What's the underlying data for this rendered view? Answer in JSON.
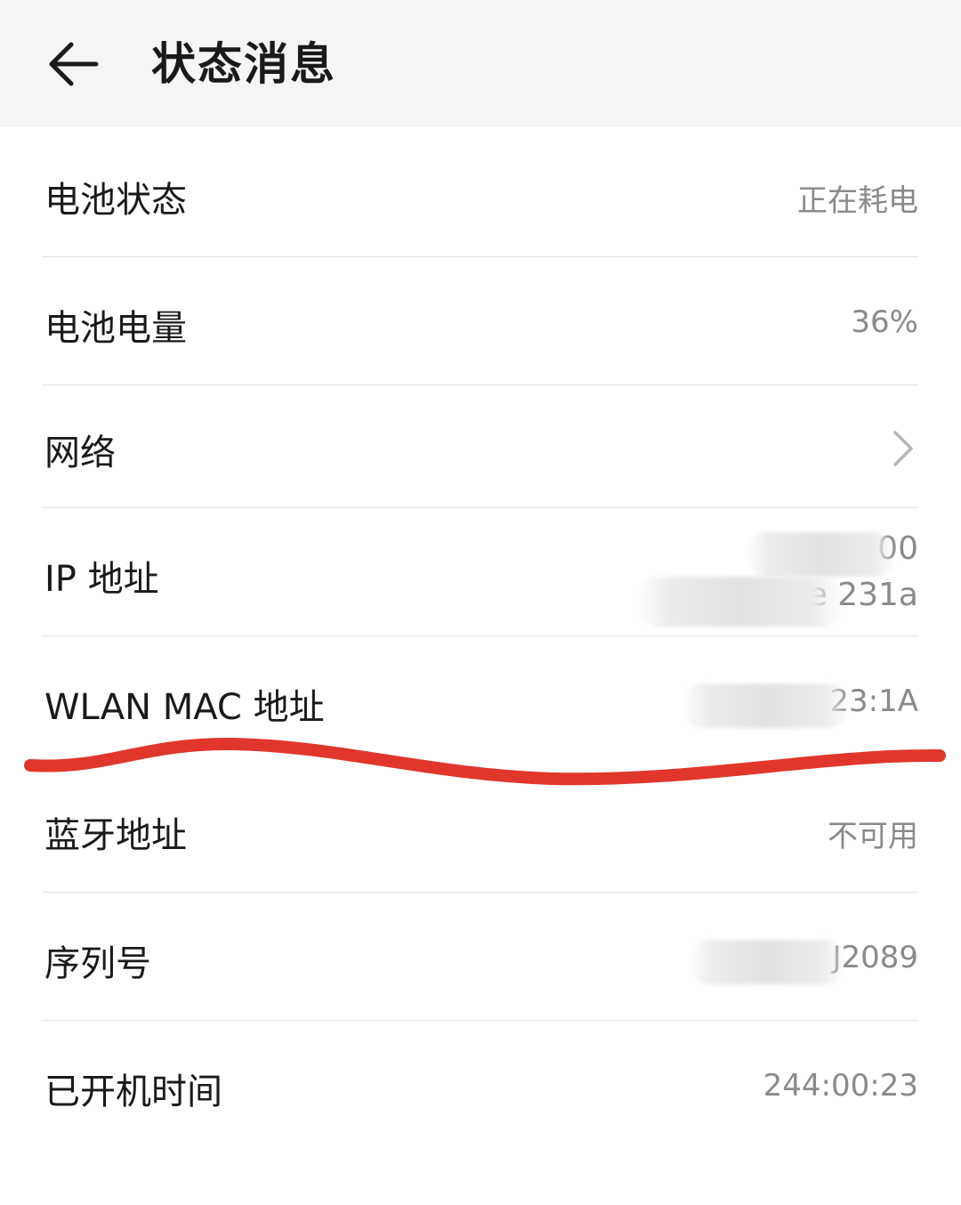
{
  "header": {
    "title": "状态消息",
    "back_icon": "arrow-left-icon"
  },
  "rows": {
    "battery_status": {
      "label": "电池状态",
      "value": "正在耗电"
    },
    "battery_level": {
      "label": "电池电量",
      "value": "36%"
    },
    "network": {
      "label": "网络",
      "icon": "chevron-right-icon"
    },
    "ip_address": {
      "label": "IP 地址",
      "value_line1": "192.        .100",
      "value_line2": "fe80::3e                          231a"
    },
    "wlan_mac": {
      "label": "WLAN MAC 地址",
      "value": "3C:C                    A:23:1A"
    },
    "bluetooth": {
      "label": "蓝牙地址",
      "value": "不可用"
    },
    "serial": {
      "label": "序列号",
      "value": "6EJ4                          J2089"
    },
    "uptime": {
      "label": "已开机时间",
      "value": "244:00:23"
    }
  },
  "colors": {
    "header_bg": "#f5f5f5",
    "value_text": "#8a8a8a",
    "annotation_red": "#e0362c"
  }
}
